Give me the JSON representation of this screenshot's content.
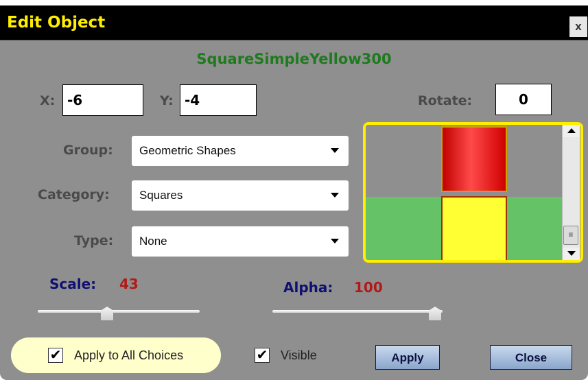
{
  "dialog": {
    "title": "Edit Object",
    "close_glyph": "x",
    "object_name": "SquareSimpleYellow300"
  },
  "position": {
    "x_label": "X:",
    "x_value": "-6",
    "y_label": "Y:",
    "y_value": "-4",
    "rotate_label": "Rotate:",
    "rotate_value": "0"
  },
  "selectors": {
    "group_label": "Group:",
    "group_value": "Geometric Shapes",
    "category_label": "Category:",
    "category_value": "Squares",
    "type_label": "Type:",
    "type_value": "None"
  },
  "sliders": {
    "scale_label": "Scale:",
    "scale_value": "43",
    "alpha_label": "Alpha:",
    "alpha_value": "100"
  },
  "options": {
    "apply_all_label": "Apply to All Choices",
    "apply_all_checked": true,
    "visible_label": "Visible",
    "visible_checked": true,
    "check_glyph": "✔"
  },
  "buttons": {
    "apply_label": "Apply",
    "close_label": "Close"
  },
  "colors": {
    "title_text": "#ffee00",
    "object_name": "#1f7a1f",
    "preview_border": "#ffee00",
    "slider_label": "#101070",
    "slider_value": "#b01a1a"
  },
  "icons": {
    "scroll_thumb_glyph": "≡"
  }
}
